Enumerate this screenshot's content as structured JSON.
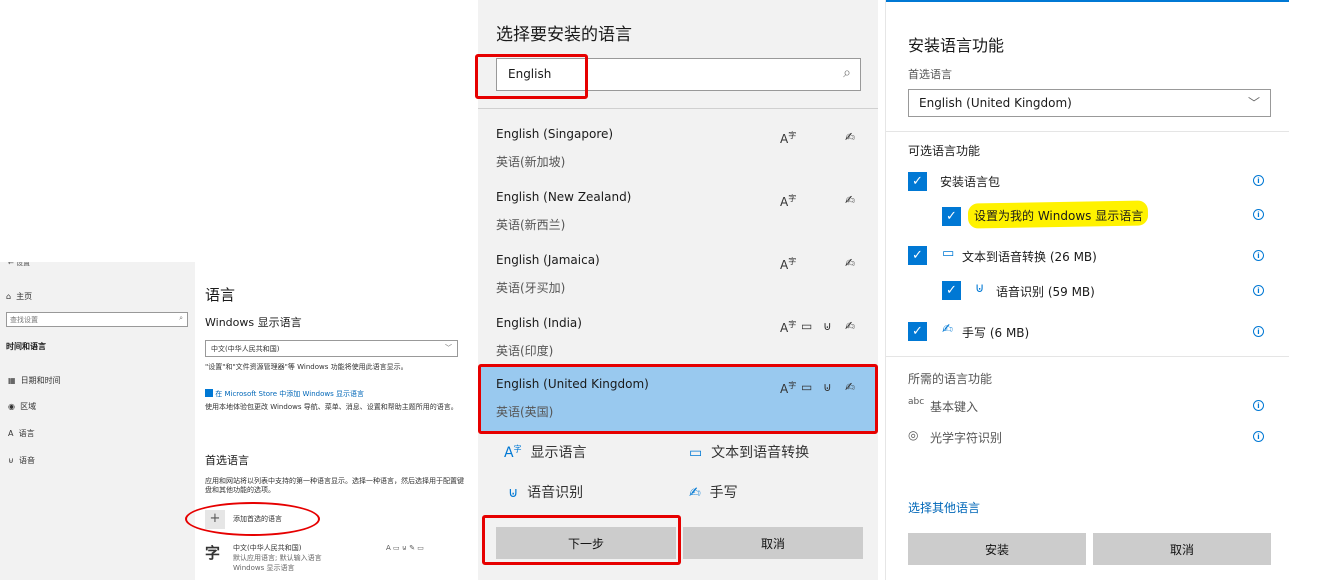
{
  "left": {
    "back_label": "设置",
    "nav": [
      {
        "icon": "home-icon",
        "label": "主页"
      },
      {
        "icon": "calendar-icon",
        "label": "日期和时间"
      },
      {
        "icon": "globe-icon",
        "label": "区域"
      },
      {
        "icon": "language-icon",
        "label": "语言"
      },
      {
        "icon": "mic-icon",
        "label": "语音"
      }
    ],
    "search_placeholder": "查找设置",
    "category": "时间和语言",
    "page_title": "语言",
    "display_lang_heading": "Windows 显示语言",
    "display_lang_value": "中文(中华人民共和国)",
    "display_lang_note": "\"设置\"和\"文件资源管理器\"等 Windows 功能将使用此语言显示。",
    "store_link": "在 Microsoft Store 中添加 Windows 显示语言",
    "store_note": "使用本地体验包更改 Windows 导航、菜单、消息、设置和帮助主题所用的语言。",
    "pref_heading": "首选语言",
    "pref_note": "应用和网站将以列表中支持的第一种语言显示。选择一种语言，然后选择用于配置键盘和其他功能的选项。",
    "add_label": "添加首选的语言",
    "lang_item": {
      "name": "中文(中华人民共和国)",
      "sub1": "默认应用语言; 默认输入语言",
      "sub2": "Windows 显示语言"
    }
  },
  "middle": {
    "title": "选择要安装的语言",
    "search_value": "English",
    "languages": [
      {
        "name": "English (Singapore)",
        "zh": "英语(新加坡)",
        "icons": [
          "display-language-icon",
          "handwriting-icon"
        ]
      },
      {
        "name": "English (New Zealand)",
        "zh": "英语(新西兰)",
        "icons": [
          "display-language-icon",
          "handwriting-icon"
        ]
      },
      {
        "name": "English (Jamaica)",
        "zh": "英语(牙买加)",
        "icons": [
          "display-language-icon",
          "handwriting-icon"
        ]
      },
      {
        "name": "English (India)",
        "zh": "英语(印度)",
        "icons": [
          "display-language-icon",
          "text-to-speech-icon",
          "speech-recognition-icon",
          "handwriting-icon"
        ]
      },
      {
        "name": "English (United Kingdom)",
        "zh": "英语(英国)",
        "icons": [
          "display-language-icon",
          "text-to-speech-icon",
          "speech-recognition-icon",
          "handwriting-icon"
        ]
      }
    ],
    "legend": {
      "display": "显示语言",
      "tts": "文本到语音转换",
      "speech": "语音识别",
      "handwriting": "手写"
    },
    "next_button": "下一步",
    "cancel_button": "取消",
    "selected_bg": "#99c9ef",
    "highlight_color": "#e60000"
  },
  "right": {
    "title": "安装语言功能",
    "preferred_label": "首选语言",
    "preferred_value": "English (United Kingdom)",
    "optional_heading": "可选语言功能",
    "features": [
      {
        "label": "安装语言包",
        "checked": true
      },
      {
        "label": "设置为我的 Windows 显示语言",
        "checked": true
      },
      {
        "label": "文本到语音转换 (26 MB)",
        "checked": true
      },
      {
        "label": "语音识别 (59 MB)",
        "checked": true
      },
      {
        "label": "手写 (6 MB)",
        "checked": true
      }
    ],
    "required_heading": "所需的语言功能",
    "required": [
      {
        "label": "基本键入"
      },
      {
        "label": "光学字符识别"
      }
    ],
    "other_link": "选择其他语言",
    "install_button": "安装",
    "cancel_button": "取消",
    "accent": "#0078d4"
  }
}
